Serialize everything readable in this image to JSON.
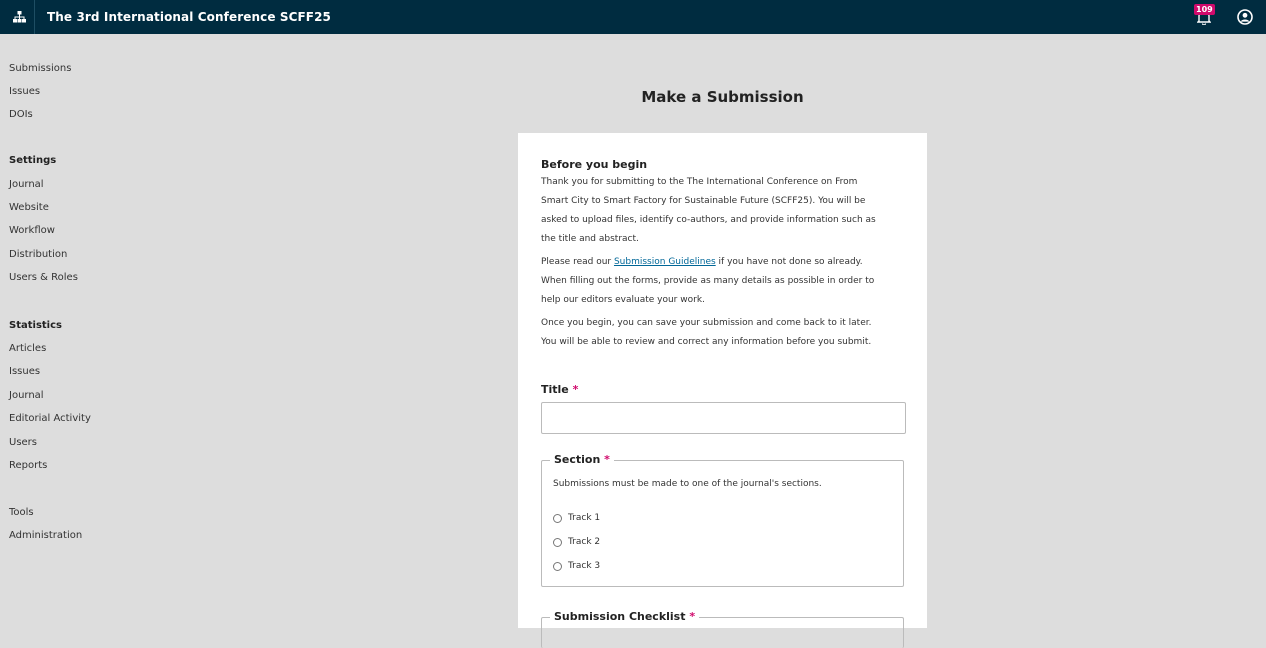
{
  "header": {
    "app_title": "The 3rd International Conference SCFF25",
    "notification_count": "109"
  },
  "sidebar": {
    "group1": [
      "Submissions",
      "Issues",
      "DOIs"
    ],
    "settings_heading": "Settings",
    "settings": [
      "Journal",
      "Website",
      "Workflow",
      "Distribution",
      "Users & Roles"
    ],
    "statistics_heading": "Statistics",
    "statistics": [
      "Articles",
      "Issues",
      "Journal",
      "Editorial Activity",
      "Users",
      "Reports"
    ],
    "tools": "Tools",
    "administration": "Administration"
  },
  "main": {
    "page_title": "Make a Submission",
    "before_heading": "Before you begin",
    "para1_lines": [
      "Thank you for submitting to the The International Conference on From",
      "Smart City to Smart Factory for Sustainable Future (SCFF25). You will be",
      "asked to upload files, identify co-authors, and provide information such as",
      "the title and abstract."
    ],
    "para2_prefix": "Please read our ",
    "para2_link": "Submission Guidelines",
    "para2_suffix": " if you have not done so already.",
    "para2_lines": [
      "When filling out the forms, provide as many details as possible in order to",
      "help our editors evaluate your work."
    ],
    "para3_lines": [
      "Once you begin, you can save your submission and come back to it later.",
      "You will be able to review and correct any information before you submit."
    ],
    "title_label": "Title",
    "title_value": "",
    "required_mark": "*",
    "section_legend": "Section",
    "section_help": "Submissions must be made to one of the journal's sections.",
    "section_options": [
      "Track 1",
      "Track 2",
      "Track 3"
    ],
    "checklist_legend": "Submission Checklist"
  },
  "colors": {
    "topbar": "#002c40",
    "accent_required": "#d00a6c",
    "link": "#006798"
  }
}
